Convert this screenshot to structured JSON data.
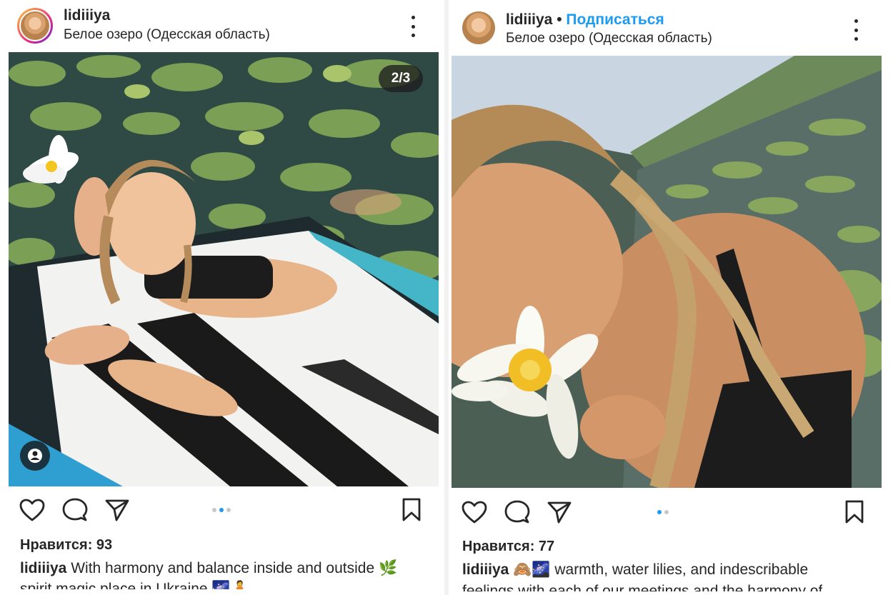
{
  "left_post": {
    "username": "lidiiiya",
    "location": "Белое озеро (Одесская область)",
    "counter": "2/3",
    "likes": "Нравится: 93",
    "caption_user": "lidiiiya",
    "caption_text": "With harmony and balance inside and outside 🌿",
    "caption_cut": "spirit magic place in Ukraine 🌌🧘",
    "icons": [
      "more-vertical-icon",
      "user-tag-icon",
      "heart-icon",
      "comment-icon",
      "share-icon",
      "bookmark-icon"
    ]
  },
  "right_post": {
    "username": "lidiiiya",
    "follow": "Подписаться",
    "location": "Белое озеро (Одесская область)",
    "likes": "Нравится: 77",
    "caption_user": "lidiiiya",
    "caption_emoji": "🙈🌌",
    "caption_text": "warmth, water lilies, and indescribable",
    "caption_cut": "feelings with each of our meetings and the harmony of",
    "icons": [
      "more-vertical-icon",
      "heart-icon",
      "comment-icon",
      "share-icon",
      "bookmark-icon"
    ]
  },
  "colors": {
    "accent": "#1d9bf0",
    "text": "#262626",
    "dot_inactive": "#c8c8c8"
  }
}
